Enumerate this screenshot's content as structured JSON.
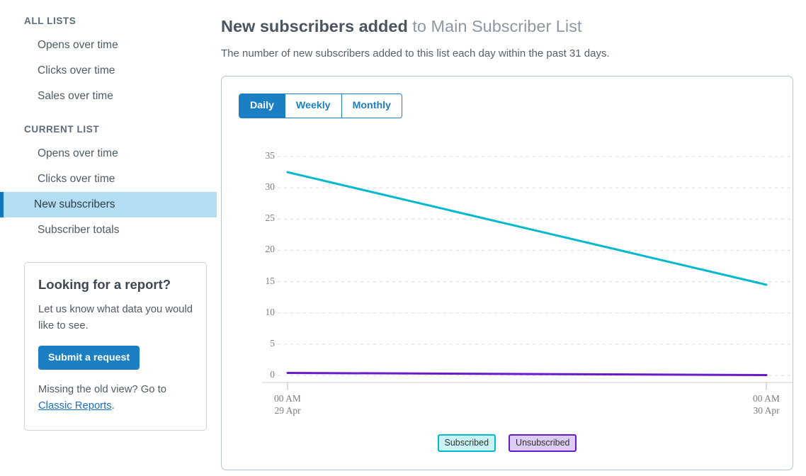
{
  "sidebar": {
    "sections": [
      {
        "title": "ALL LISTS",
        "items": [
          {
            "label": "Opens over time",
            "active": false
          },
          {
            "label": "Clicks over time",
            "active": false
          },
          {
            "label": "Sales over time",
            "active": false
          }
        ]
      },
      {
        "title": "CURRENT LIST",
        "items": [
          {
            "label": "Opens over time",
            "active": false
          },
          {
            "label": "Clicks over time",
            "active": false
          },
          {
            "label": "New subscribers",
            "active": true
          },
          {
            "label": "Subscriber totals",
            "active": false
          }
        ]
      }
    ],
    "report_card": {
      "heading": "Looking for a report?",
      "body": "Let us know what data you would like to see.",
      "button_label": "Submit a request",
      "footer_prefix": "Missing the old view? Go to ",
      "footer_link": "Classic Reports",
      "footer_suffix": "."
    }
  },
  "header": {
    "title_strong": "New subscribers added",
    "title_rest": " to Main Subscriber List",
    "subtitle": "The number of new subscribers added to this list each day within the past 31 days."
  },
  "controls": {
    "range_tabs": [
      {
        "label": "Daily",
        "active": true
      },
      {
        "label": "Weekly",
        "active": false
      },
      {
        "label": "Monthly",
        "active": false
      }
    ]
  },
  "colors": {
    "subscribed_line": "#00b9cf",
    "unsubscribed_line": "#6a1bc9",
    "accent_blue": "#1b7fc4",
    "active_nav_bg": "#b3ddf2",
    "active_nav_border": "#1176bc",
    "gridline": "#dcdcdc"
  },
  "chart_data": {
    "type": "line",
    "title": "",
    "xlabel": "",
    "ylabel": "",
    "ylim": [
      0,
      37
    ],
    "yticks": [
      0,
      5,
      10,
      15,
      20,
      25,
      30,
      35
    ],
    "grid": true,
    "legend_position": "bottom",
    "x_tick_labels": [
      {
        "time": "00 AM",
        "date": "29 Apr"
      },
      {
        "time": "00 AM",
        "date": "30 Apr"
      }
    ],
    "x": [
      0,
      1
    ],
    "series": [
      {
        "name": "Subscribed",
        "color": "#00b9cf",
        "values": [
          32.5,
          14.5
        ]
      },
      {
        "name": "Unsubscribed",
        "color": "#6a1bc9",
        "values": [
          0.4,
          0.05
        ]
      }
    ]
  }
}
